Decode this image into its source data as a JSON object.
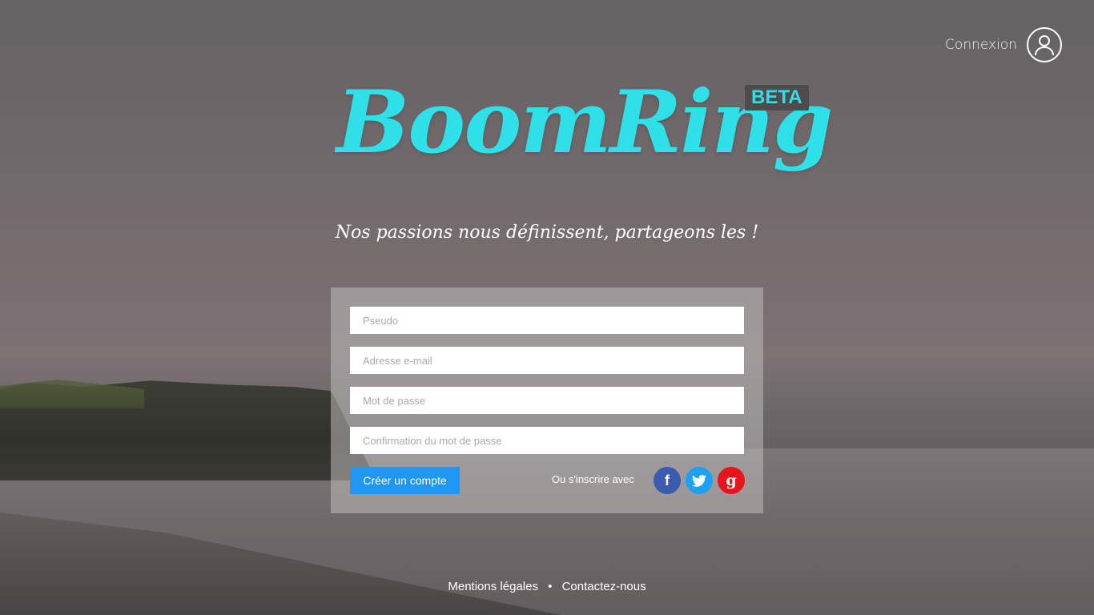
{
  "header": {
    "login_label": "Connexion"
  },
  "brand": {
    "logo_text": "BoomRing",
    "badge": "BETA",
    "tagline": "Nos passions nous définissent, partageons les !"
  },
  "form": {
    "pseudo_placeholder": "Pseudo",
    "email_placeholder": "Adresse e-mail",
    "password_placeholder": "Mot de passe",
    "confirm_placeholder": "Confirmation du mot de passe",
    "submit_label": "Créer un compte",
    "social_label": "Ou s'inscrire avec",
    "social": {
      "facebook": "f",
      "google": "g"
    }
  },
  "footer": {
    "legal": "Mentions légales",
    "separator": "•",
    "contact": "Contactez-nous"
  },
  "colors": {
    "brand": "#2ee0e8",
    "button": "#2196f3",
    "facebook": "#3b5bb0",
    "twitter": "#1da1f2",
    "google": "#e8141b"
  }
}
